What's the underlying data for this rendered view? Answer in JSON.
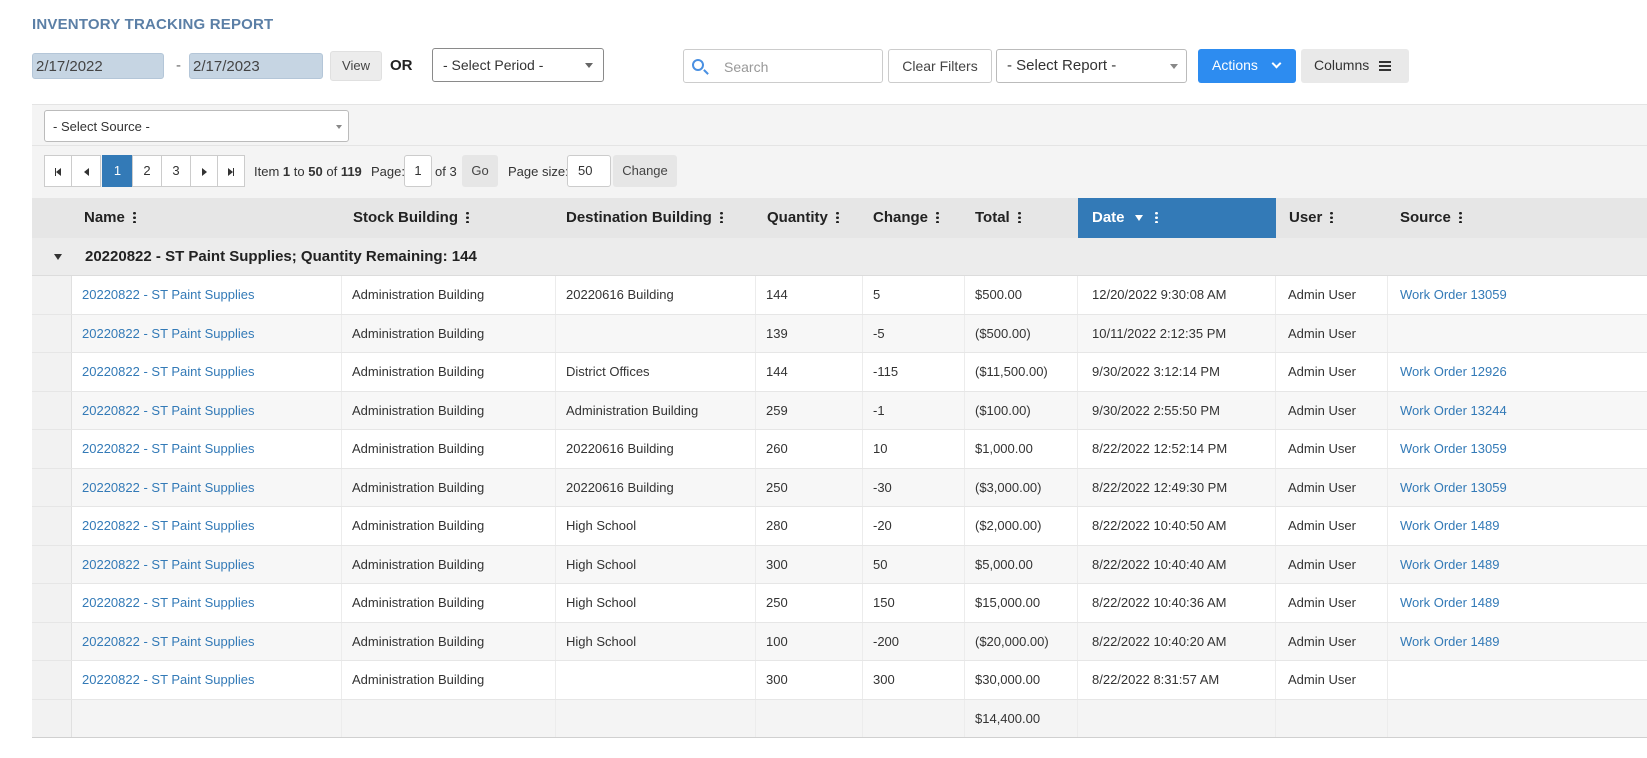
{
  "title": "INVENTORY TRACKING REPORT",
  "toolbar": {
    "date_from": "2/17/2022",
    "date_sep": "-",
    "date_to": "2/17/2023",
    "view_label": "View",
    "or_label": "OR",
    "period_placeholder": "- Select Period -",
    "search_placeholder": "Search",
    "clear_filters_label": "Clear Filters",
    "report_placeholder": "- Select Report -",
    "actions_label": "Actions",
    "columns_label": "Columns"
  },
  "source_filter": {
    "placeholder": "- Select Source -"
  },
  "pager": {
    "pages": [
      "1",
      "2",
      "3"
    ],
    "current_page": "1",
    "item_prefix": "Item",
    "item_from": "1",
    "item_to_word": "to",
    "item_to": "50",
    "item_of_word": "of",
    "item_total": "119",
    "page_label": "Page:",
    "page_value": "1",
    "of_pages": "of 3",
    "go_label": "Go",
    "page_size_label": "Page size:",
    "page_size_value": "50",
    "change_label": "Change"
  },
  "table": {
    "columns": [
      "Name",
      "Stock Building",
      "Destination Building",
      "Quantity",
      "Change",
      "Total",
      "Date",
      "User",
      "Source"
    ],
    "sorted_column": "Date",
    "group_label": "20220822 - ST Paint Supplies; Quantity Remaining: 144",
    "rows": [
      {
        "name": "20220822 - ST Paint Supplies",
        "stock": "Administration Building",
        "dest": "20220616 Building",
        "qty": "144",
        "change": "5",
        "total": "$500.00",
        "date": "12/20/2022 9:30:08 AM",
        "user": "Admin User",
        "source": "Work Order 13059"
      },
      {
        "name": "20220822 - ST Paint Supplies",
        "stock": "Administration Building",
        "dest": "",
        "qty": "139",
        "change": "-5",
        "total": "($500.00)",
        "date": "10/11/2022 2:12:35 PM",
        "user": "Admin User",
        "source": ""
      },
      {
        "name": "20220822 - ST Paint Supplies",
        "stock": "Administration Building",
        "dest": "District Offices",
        "qty": "144",
        "change": "-115",
        "total": "($11,500.00)",
        "date": "9/30/2022 3:12:14 PM",
        "user": "Admin User",
        "source": "Work Order 12926"
      },
      {
        "name": "20220822 - ST Paint Supplies",
        "stock": "Administration Building",
        "dest": "Administration Building",
        "qty": "259",
        "change": "-1",
        "total": "($100.00)",
        "date": "9/30/2022 2:55:50 PM",
        "user": "Admin User",
        "source": "Work Order 13244"
      },
      {
        "name": "20220822 - ST Paint Supplies",
        "stock": "Administration Building",
        "dest": "20220616 Building",
        "qty": "260",
        "change": "10",
        "total": "$1,000.00",
        "date": "8/22/2022 12:52:14 PM",
        "user": "Admin User",
        "source": "Work Order 13059"
      },
      {
        "name": "20220822 - ST Paint Supplies",
        "stock": "Administration Building",
        "dest": "20220616 Building",
        "qty": "250",
        "change": "-30",
        "total": "($3,000.00)",
        "date": "8/22/2022 12:49:30 PM",
        "user": "Admin User",
        "source": "Work Order 13059"
      },
      {
        "name": "20220822 - ST Paint Supplies",
        "stock": "Administration Building",
        "dest": "High School",
        "qty": "280",
        "change": "-20",
        "total": "($2,000.00)",
        "date": "8/22/2022 10:40:50 AM",
        "user": "Admin User",
        "source": "Work Order 1489"
      },
      {
        "name": "20220822 - ST Paint Supplies",
        "stock": "Administration Building",
        "dest": "High School",
        "qty": "300",
        "change": "50",
        "total": "$5,000.00",
        "date": "8/22/2022 10:40:40 AM",
        "user": "Admin User",
        "source": "Work Order 1489"
      },
      {
        "name": "20220822 - ST Paint Supplies",
        "stock": "Administration Building",
        "dest": "High School",
        "qty": "250",
        "change": "150",
        "total": "$15,000.00",
        "date": "8/22/2022 10:40:36 AM",
        "user": "Admin User",
        "source": "Work Order 1489"
      },
      {
        "name": "20220822 - ST Paint Supplies",
        "stock": "Administration Building",
        "dest": "High School",
        "qty": "100",
        "change": "-200",
        "total": "($20,000.00)",
        "date": "8/22/2022 10:40:20 AM",
        "user": "Admin User",
        "source": "Work Order 1489"
      },
      {
        "name": "20220822 - ST Paint Supplies",
        "stock": "Administration Building",
        "dest": "",
        "qty": "300",
        "change": "300",
        "total": "$30,000.00",
        "date": "8/22/2022 8:31:57 AM",
        "user": "Admin User",
        "source": ""
      }
    ],
    "footer_total": "$14,400.00"
  },
  "colors": {
    "accent": "#337ab7",
    "primary_button": "#2d8cf0",
    "title": "#5b7fa6"
  }
}
